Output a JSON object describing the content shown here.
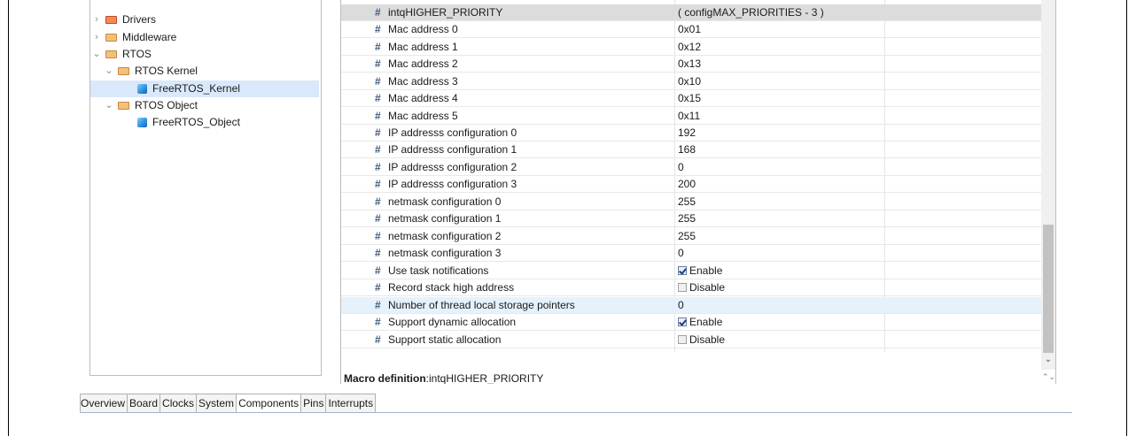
{
  "tree": {
    "items": [
      {
        "label": "Drivers",
        "twisty": "›",
        "icon": "folder-icon",
        "accent": "#f08a5d"
      },
      {
        "label": "Middleware",
        "twisty": "›",
        "icon": "folder-icon"
      },
      {
        "label": "RTOS",
        "twisty": "⌄",
        "icon": "folder-icon"
      },
      {
        "label": "RTOS Kernel",
        "twisty": "⌄",
        "icon": "folder-icon"
      },
      {
        "label": "FreeRTOS_Kernel",
        "icon": "cube-icon",
        "selected": true
      },
      {
        "label": "RTOS Object",
        "twisty": "⌄",
        "icon": "folder-icon"
      },
      {
        "label": "FreeRTOS_Object",
        "icon": "cube-icon"
      }
    ]
  },
  "params": {
    "hash_symbol": "#",
    "rows": [
      {
        "name": "intqHIGHER_PRIORITY",
        "value": "( configMAX_PRIORITIES - 3 )"
      },
      {
        "name": "Mac address 0",
        "value": "0x01"
      },
      {
        "name": "Mac address 1",
        "value": "0x12"
      },
      {
        "name": "Mac address 2",
        "value": "0x13"
      },
      {
        "name": "Mac address 3",
        "value": "0x10"
      },
      {
        "name": "Mac address 4",
        "value": "0x15"
      },
      {
        "name": "Mac address 5",
        "value": "0x11"
      },
      {
        "name": "IP addresss configuration 0",
        "value": "192"
      },
      {
        "name": "IP addresss configuration 1",
        "value": "168"
      },
      {
        "name": "IP addresss configuration 2",
        "value": "0"
      },
      {
        "name": "IP addresss configuration 3",
        "value": "200"
      },
      {
        "name": "netmask configuration 0",
        "value": "255"
      },
      {
        "name": "netmask configuration 1",
        "value": "255"
      },
      {
        "name": "netmask configuration 2",
        "value": "255"
      },
      {
        "name": "netmask configuration 3",
        "value": "0"
      },
      {
        "name": "Use task notifications",
        "value": "Enable",
        "checked": true
      },
      {
        "name": "Record stack high address",
        "value": "Disable",
        "checked": false
      },
      {
        "name": "Number of thread local storage pointers",
        "value": "0",
        "selected": true
      },
      {
        "name": "Support dynamic allocation",
        "value": "Enable",
        "checked": true
      },
      {
        "name": "Support static allocation",
        "value": "Disable",
        "checked": false
      }
    ]
  },
  "macro": {
    "label": "Macro definition",
    "value": ":intqHIGHER_PRIORITY"
  },
  "tabs": [
    {
      "label": "Overview"
    },
    {
      "label": "Board"
    },
    {
      "label": "Clocks"
    },
    {
      "label": "System"
    },
    {
      "label": "Components",
      "active": true
    },
    {
      "label": "Pins"
    },
    {
      "label": "Interrupts"
    }
  ]
}
